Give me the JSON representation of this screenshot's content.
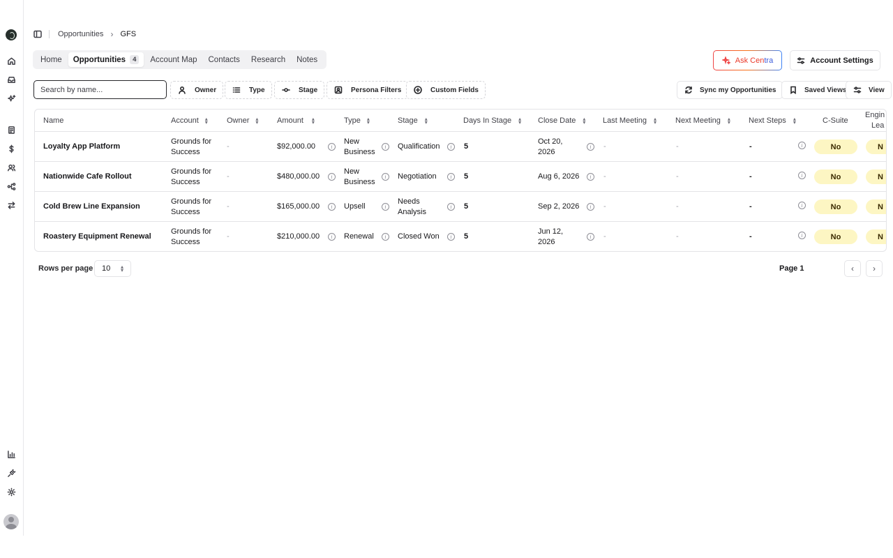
{
  "breadcrumb": {
    "parent": "Opportunities",
    "current": "GFS"
  },
  "tabs": [
    {
      "label": "Home"
    },
    {
      "label": "Opportunities",
      "count": "4"
    },
    {
      "label": "Account Map"
    },
    {
      "label": "Contacts"
    },
    {
      "label": "Research"
    },
    {
      "label": "Notes"
    }
  ],
  "actions": {
    "ask_prefix": "Ask Cen",
    "ask_suffix": "tra",
    "account_settings": "Account Settings"
  },
  "search": {
    "placeholder": "Search by name..."
  },
  "filters": {
    "owner": "Owner",
    "type": "Type",
    "stage": "Stage",
    "persona": "Persona Filters",
    "custom": "Custom Fields",
    "sync": "Sync my Opportunities",
    "saved_views": "Saved Views",
    "view": "View"
  },
  "columns": {
    "name": "Name",
    "account": "Account",
    "owner": "Owner",
    "amount": "Amount",
    "type": "Type",
    "stage": "Stage",
    "days": "Days In Stage",
    "close": "Close Date",
    "last_meeting": "Last Meeting",
    "next_meeting": "Next Meeting",
    "next_steps": "Next Steps",
    "csuite": "C-Suite",
    "eng_lead_a": "Engin",
    "eng_lead_b": "Lea"
  },
  "rows": [
    {
      "name": "Loyalty App Platform",
      "account_a": "Grounds for",
      "account_b": "Success",
      "owner": "-",
      "amount": "$92,000.00",
      "type_a": "New",
      "type_b": "Business",
      "stage_a": "Qualification",
      "stage_b": "",
      "days": "5",
      "close_a": "Oct 20,",
      "close_b": "2026",
      "last": "-",
      "next": "-",
      "steps": "-",
      "csuite": "No",
      "eng": "N"
    },
    {
      "name": "Nationwide Cafe Rollout",
      "account_a": "Grounds for",
      "account_b": "Success",
      "owner": "-",
      "amount": "$480,000.00",
      "type_a": "New",
      "type_b": "Business",
      "stage_a": "Negotiation",
      "stage_b": "",
      "days": "5",
      "close_a": "Aug 6, 2026",
      "close_b": "",
      "last": "-",
      "next": "-",
      "steps": "-",
      "csuite": "No",
      "eng": "N"
    },
    {
      "name": "Cold Brew Line Expansion",
      "account_a": "Grounds for",
      "account_b": "Success",
      "owner": "-",
      "amount": "$165,000.00",
      "type_a": "Upsell",
      "type_b": "",
      "stage_a": "Needs",
      "stage_b": "Analysis",
      "days": "5",
      "close_a": "Sep 2, 2026",
      "close_b": "",
      "last": "-",
      "next": "-",
      "steps": "-",
      "csuite": "No",
      "eng": "N"
    },
    {
      "name": "Roastery Equipment Renewal",
      "account_a": "Grounds for",
      "account_b": "Success",
      "owner": "-",
      "amount": "$210,000.00",
      "type_a": "Renewal",
      "type_b": "",
      "stage_a": "Closed Won",
      "stage_b": "",
      "days": "5",
      "close_a": "Jun 12,",
      "close_b": "2026",
      "last": "-",
      "next": "-",
      "steps": "-",
      "csuite": "No",
      "eng": "N"
    }
  ],
  "footer": {
    "rows_per_page_label": "Rows per page",
    "rows_per_page_value": "10",
    "page": "Page 1"
  },
  "colors": {
    "pill_bg": "#fdf6c3",
    "ask_red": "#ea3a2a",
    "ask_blue": "#3b5bdb"
  }
}
